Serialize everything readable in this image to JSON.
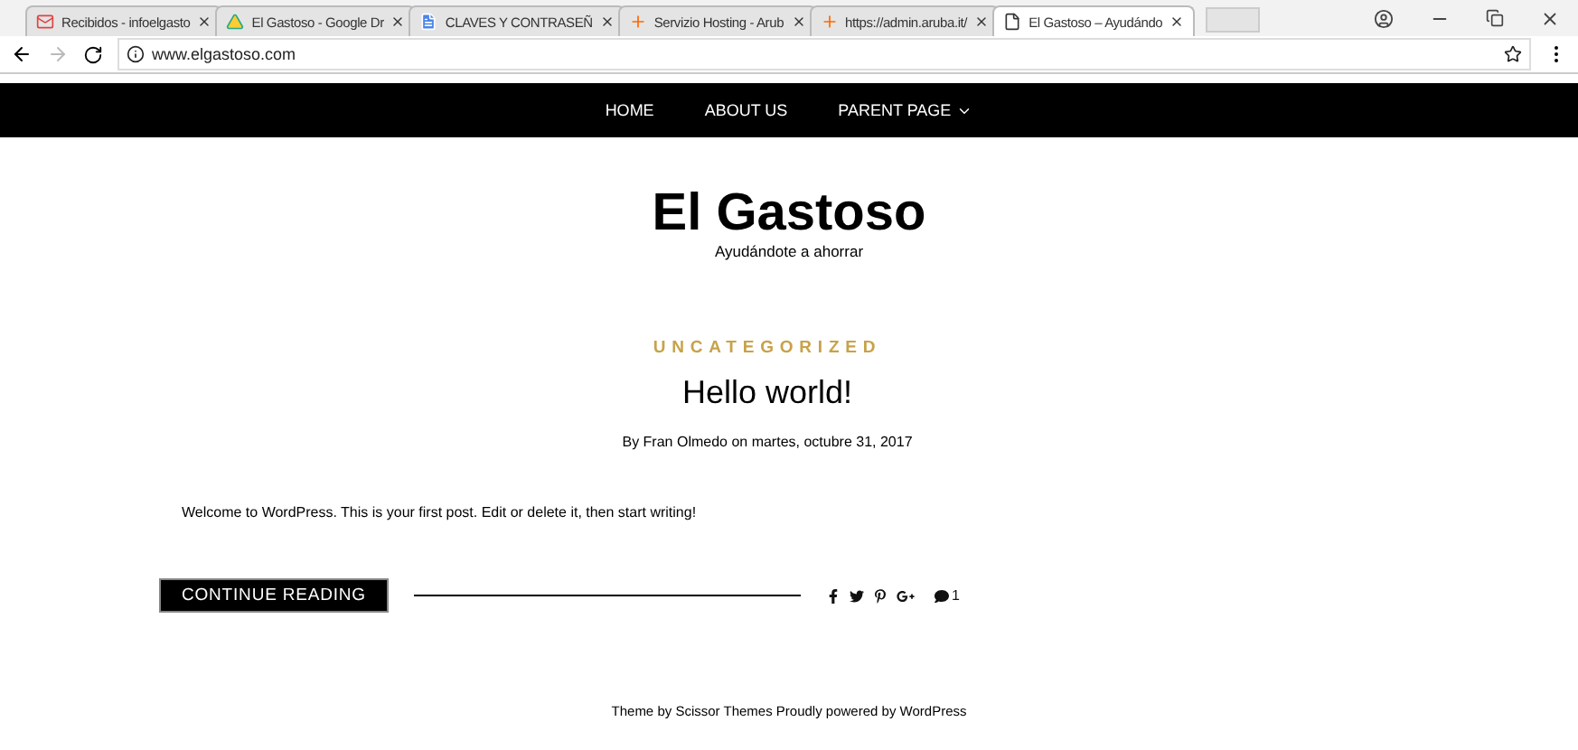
{
  "browser": {
    "tabs": [
      {
        "title": "Recibidos - infoelgasto",
        "kind": "mail",
        "selected": false
      },
      {
        "title": "El Gastoso - Google Dr",
        "kind": "drive",
        "selected": false
      },
      {
        "title": "CLAVES Y CONTRASEÑ",
        "kind": "doc",
        "selected": false
      },
      {
        "title": "Servizio Hosting - Arub",
        "kind": "plus",
        "selected": false
      },
      {
        "title": "https://admin.aruba.it/",
        "kind": "plus",
        "selected": false
      },
      {
        "title": "El Gastoso – Ayudándo",
        "kind": "page",
        "selected": true
      }
    ],
    "url": "www.elgastoso.com"
  },
  "nav": [
    {
      "label": "HOME",
      "dropdown": false
    },
    {
      "label": "ABOUT US",
      "dropdown": false
    },
    {
      "label": "PARENT PAGE",
      "dropdown": true
    }
  ],
  "site": {
    "title": "El Gastoso",
    "tagline": "Ayudándote a ahorrar"
  },
  "post": {
    "category": "UNCATEGORIZED",
    "title": "Hello world!",
    "byline": "By Fran Olmedo on martes, octubre 31, 2017",
    "excerpt": "Welcome to WordPress. This is your first post. Edit or delete it, then start writing!",
    "button": "CONTINUE READING",
    "comments": "1"
  },
  "footer": "Theme by Scissor Themes Proudly powered by WordPress"
}
